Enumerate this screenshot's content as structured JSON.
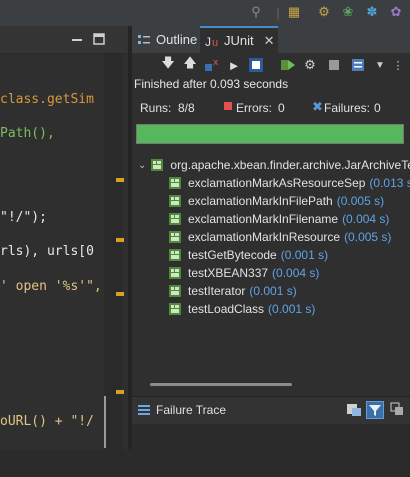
{
  "editor": {
    "code_lines": [
      "class.getSim",
      "Path(),",
      "\"!/\");",
      "rls), urls[0",
      "' open '%s'\",",
      "oURL() + \"!/"
    ]
  },
  "views": {
    "outline_tab": "Outline",
    "junit_tab": "JUnit"
  },
  "junit": {
    "status": "Finished after 0.093 seconds",
    "runs_label": "Runs:",
    "runs_value": "8/8",
    "errors_label": "Errors:",
    "errors_value": "0",
    "failures_label": "Failures:",
    "failures_value": "0",
    "progress_fraction": 1.0,
    "suite": "org.apache.xbean.finder.archive.JarArchiveTe",
    "tests": [
      {
        "name": "exclamationMarkAsResourceSep",
        "time": "(0.013 s)"
      },
      {
        "name": "exclamationMarkInFilePath",
        "time": "(0.005 s)"
      },
      {
        "name": "exclamationMarkInFilename",
        "time": "(0.004 s)"
      },
      {
        "name": "exclamationMarkInResource",
        "time": "(0.005 s)"
      },
      {
        "name": "testGetBytecode",
        "time": "(0.001 s)"
      },
      {
        "name": "testXBEAN337",
        "time": "(0.004 s)"
      },
      {
        "name": "testIterator",
        "time": "(0.001 s)"
      },
      {
        "name": "testLoadClass",
        "time": "(0.001 s)"
      }
    ],
    "failure_trace_title": "Failure Trace"
  },
  "colors": {
    "progress_ok": "#55b85c",
    "time_text": "#5fa3e6",
    "tab_accent": "#4a88c7"
  }
}
